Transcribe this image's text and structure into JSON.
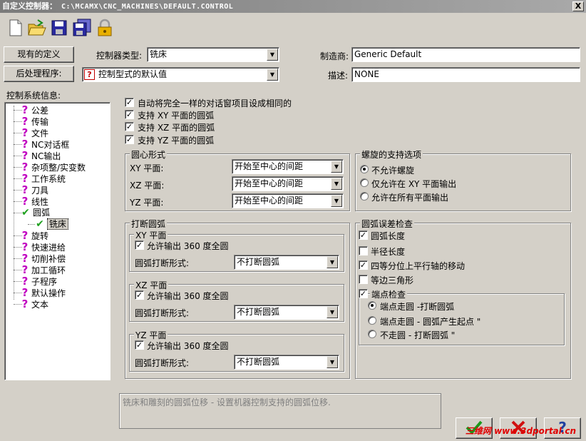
{
  "window": {
    "title": "自定义控制器：",
    "path": "C:\\MCAMX\\CNC_MACHINES\\DEFAULT.CONTROL",
    "close_label": "X"
  },
  "toolbar": {
    "icons": [
      "new-file-icon",
      "open-folder-icon",
      "save-icon",
      "save-all-icon",
      "lock-icon"
    ]
  },
  "top": {
    "existing_defs_label": "现有的定义",
    "post_processor_label": "后处理程序:",
    "controller_type_label": "控制器类型:",
    "controller_type_value": "铣床",
    "post_value": "控制型式的默认值",
    "manufacturer_label": "制造商:",
    "manufacturer_value": "Generic Default",
    "description_label": "描述:",
    "description_value": "NONE"
  },
  "tree": {
    "header": "控制系统信息:",
    "items": [
      {
        "label": "公差",
        "icon": "question-icon"
      },
      {
        "label": "传输",
        "icon": "question-icon"
      },
      {
        "label": "文件",
        "icon": "question-icon"
      },
      {
        "label": "NC对话框",
        "icon": "question-icon"
      },
      {
        "label": "NC输出",
        "icon": "question-icon"
      },
      {
        "label": "杂项整/实变数",
        "icon": "question-icon"
      },
      {
        "label": "工作系统",
        "icon": "question-icon"
      },
      {
        "label": "刀具",
        "icon": "question-icon"
      },
      {
        "label": "线性",
        "icon": "question-icon"
      },
      {
        "label": "圆弧",
        "icon": "check-icon"
      },
      {
        "label": "铣床",
        "icon": "check-icon",
        "child": true,
        "selected": true
      },
      {
        "label": "旋转",
        "icon": "question-icon"
      },
      {
        "label": "快速进给",
        "icon": "question-icon"
      },
      {
        "label": "切削补偿",
        "icon": "question-icon"
      },
      {
        "label": "加工循环",
        "icon": "question-icon"
      },
      {
        "label": "子程序",
        "icon": "question-icon"
      },
      {
        "label": "默认操作",
        "icon": "question-icon"
      },
      {
        "label": "文本",
        "icon": "question-icon"
      }
    ]
  },
  "options": {
    "auto_same": {
      "label": "自动将完全一样的对话窗项目设成相同的",
      "checked": true
    },
    "xy_arc": {
      "label": "支持 XY 平面的圆弧",
      "checked": true
    },
    "xz_arc": {
      "label": "支持 XZ 平面的圆弧",
      "checked": true
    },
    "yz_arc": {
      "label": "支持 YZ 平面的圆弧",
      "checked": true
    }
  },
  "center_format": {
    "title": "圆心形式",
    "rows": [
      {
        "label": "XY 平面:",
        "value": "开始至中心的间距"
      },
      {
        "label": "XZ 平面:",
        "value": "开始至中心的间距"
      },
      {
        "label": "YZ 平面:",
        "value": "开始至中心的间距"
      }
    ]
  },
  "helix": {
    "title": "螺旋的支持选项",
    "options": [
      {
        "label": "不允许螺旋",
        "selected": true
      },
      {
        "label": "仅允许在 XY 平面输出",
        "selected": false
      },
      {
        "label": "允许在所有平面输出",
        "selected": false
      }
    ]
  },
  "break_arc": {
    "title": "打断圆弧",
    "planes": [
      {
        "title": "XY 平面",
        "allow_label": "允许输出 360 度全圆",
        "checked": true,
        "form_label": "圆弧打断形式:",
        "form_value": "不打断圆弧"
      },
      {
        "title": "XZ 平面",
        "allow_label": "允许输出 360 度全圆",
        "checked": true,
        "form_label": "圆弧打断形式:",
        "form_value": "不打断圆弧"
      },
      {
        "title": "YZ 平面",
        "allow_label": "允许输出 360 度全圆",
        "checked": true,
        "form_label": "圆弧打断形式:",
        "form_value": "不打断圆弧"
      }
    ]
  },
  "arc_error": {
    "title": "圆弧误差检查",
    "checks": [
      {
        "label": "圆弧长度",
        "checked": true
      },
      {
        "label": "半径长度",
        "checked": false
      },
      {
        "label": "四等分位上平行轴的移动",
        "checked": true
      },
      {
        "label": "等边三角形",
        "checked": false
      }
    ],
    "endpoint": {
      "label": "端点检查",
      "checked": true,
      "options": [
        {
          "label": "端点走圆 -打断圆弧",
          "selected": true
        },
        {
          "label": "端点走圆 - 圆弧产生起点 \"",
          "selected": false
        },
        {
          "label": "不走圆 - 打断圆弧 \"",
          "selected": false
        }
      ]
    }
  },
  "status": {
    "text": "铣床和雕刻的圆弧位移 - 设置机器控制支持的圆弧位移."
  },
  "buttons": {
    "ok_icon": "check-icon",
    "cancel_icon": "x-icon",
    "help_icon": "help-icon",
    "help_label": "?"
  },
  "watermark": "三维网 www.3dportal.cn"
}
